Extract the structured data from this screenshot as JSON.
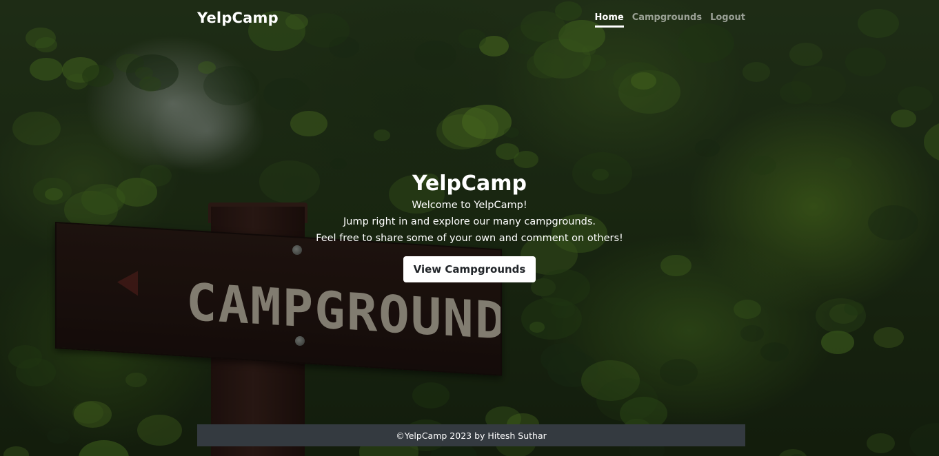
{
  "navbar": {
    "brand": "YelpCamp",
    "links": [
      {
        "label": "Home",
        "active": true
      },
      {
        "label": "Campgrounds",
        "active": false
      },
      {
        "label": "Logout",
        "active": false
      }
    ]
  },
  "hero": {
    "title": "YelpCamp",
    "lines": [
      "Welcome to YelpCamp!",
      "Jump right in and explore our many campgrounds.",
      "Feel free to share some of your own and comment on others!"
    ],
    "button_label": "View Campgrounds"
  },
  "background": {
    "sign_text": "CAMPGROUND"
  },
  "footer": {
    "text": "©YelpCamp 2023 by Hitesh Suthar"
  },
  "colors": {
    "footer_bg": "#343a40",
    "nav_active": "#ffffff",
    "nav_inactive": "rgba(255,255,255,0.55)"
  }
}
